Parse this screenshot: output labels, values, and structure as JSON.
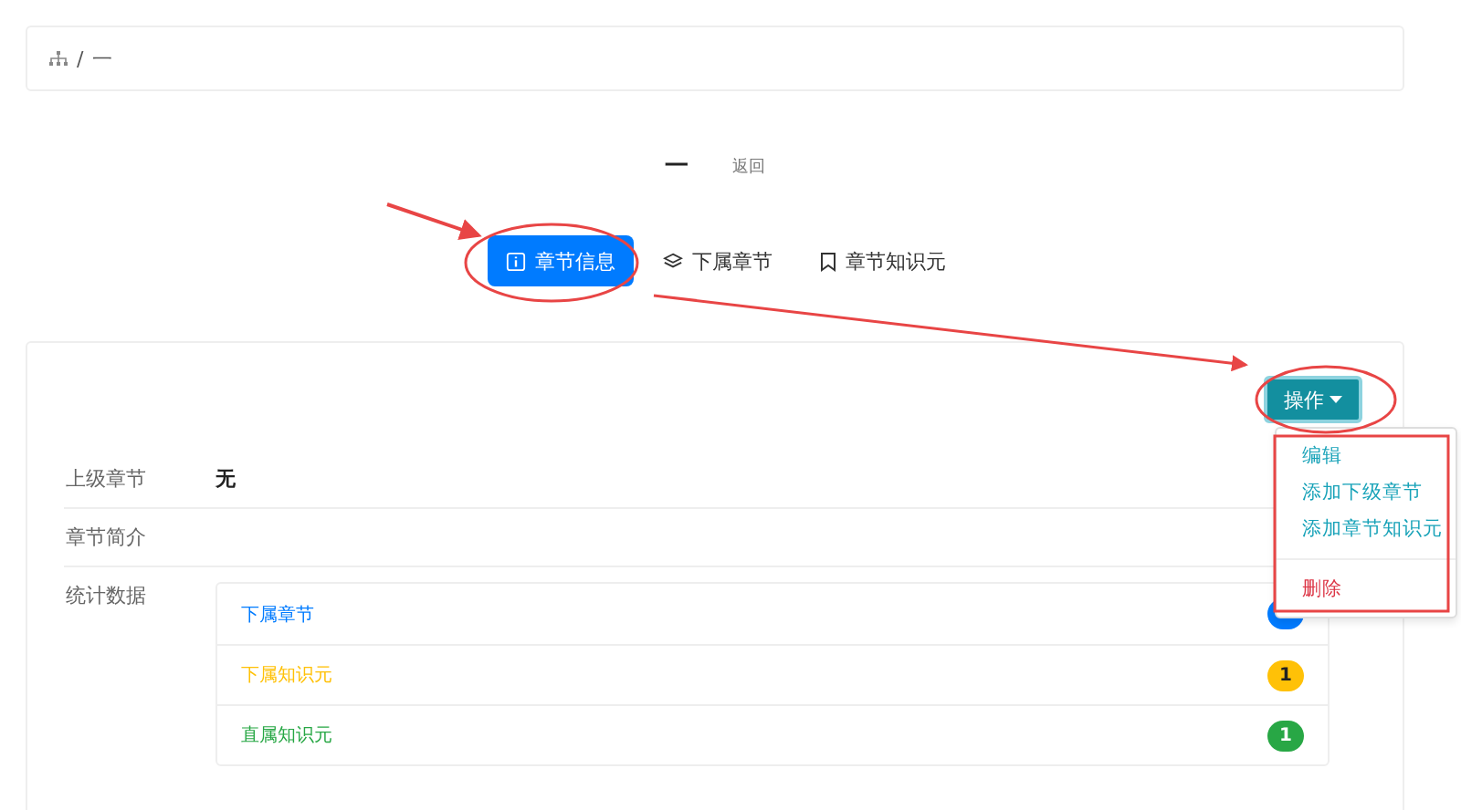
{
  "breadcrumb": {
    "separator": "/",
    "current": "一"
  },
  "header": {
    "title": "一",
    "back_link": "返回"
  },
  "tabs": [
    {
      "label": "章节信息",
      "selected": true
    },
    {
      "label": "下属章节",
      "selected": false
    },
    {
      "label": "章节知识元",
      "selected": false
    }
  ],
  "actions": {
    "label": "操作",
    "expanded": true,
    "menu": [
      {
        "label": "编辑",
        "kind": "item"
      },
      {
        "label": "添加下级章节",
        "kind": "item"
      },
      {
        "label": "添加章节知识元",
        "kind": "item"
      },
      {
        "kind": "divider"
      },
      {
        "label": "删除",
        "kind": "danger"
      }
    ]
  },
  "details": [
    {
      "label": "上级章节",
      "value": "无"
    },
    {
      "label": "章节简介"
    }
  ],
  "statistics": {
    "label": "统计数据",
    "items": [
      {
        "label": "下属章节",
        "color": "#007bff"
      },
      {
        "label": "下属知识元",
        "color": "#ffc107",
        "count": "1"
      },
      {
        "label": "直属知识元",
        "color": "#28a745",
        "count": "1"
      }
    ]
  }
}
